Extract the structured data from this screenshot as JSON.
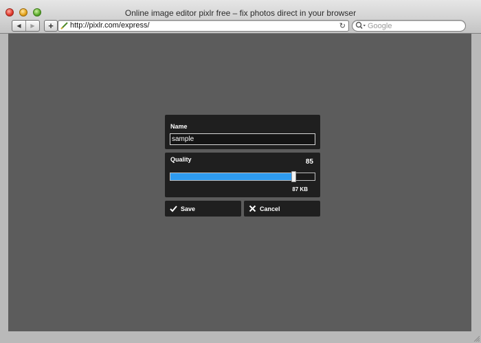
{
  "window": {
    "title": "Online image editor pixlr free – fix photos direct in your browser"
  },
  "toolbar": {
    "back_icon": "back-arrow-icon",
    "forward_icon": "forward-arrow-icon",
    "add_icon": "plus-icon",
    "url": "http://pixlr.com/express/",
    "reload_icon": "reload-icon",
    "search_placeholder": "Google"
  },
  "save_dialog": {
    "name_label": "Name",
    "name_value": "sample",
    "quality_label": "Quality",
    "quality_value": "85",
    "quality_fraction": 0.85,
    "file_size": "87 KB",
    "save_label": "Save",
    "cancel_label": "Cancel"
  },
  "colors": {
    "content_background": "#5c5c5c",
    "panel_background": "#1f1f1f",
    "slider_fill": "#2e9bf0"
  }
}
